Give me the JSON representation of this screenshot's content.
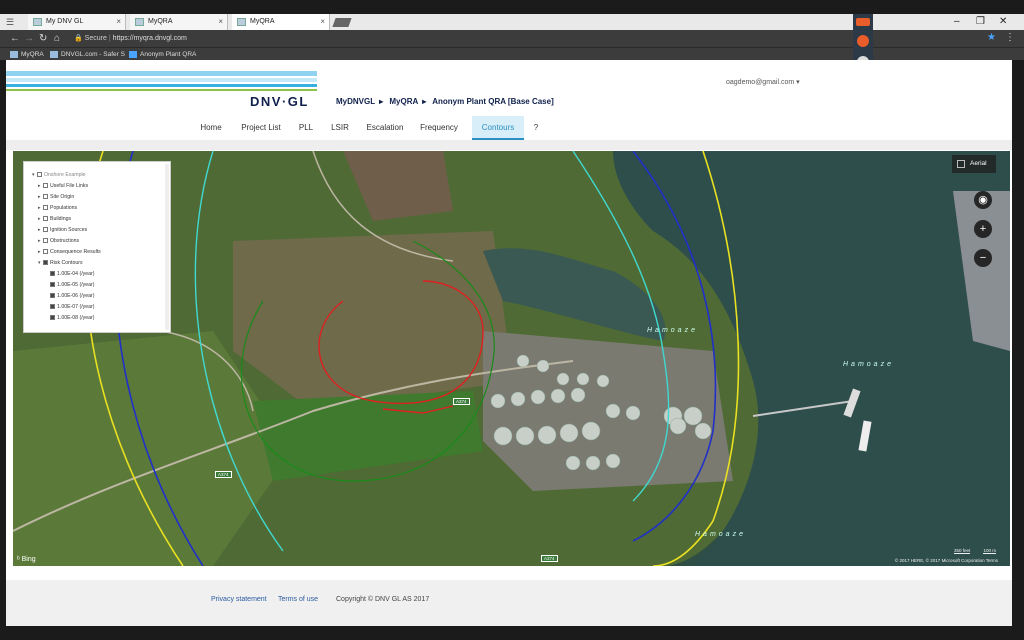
{
  "browser": {
    "tabs": [
      {
        "label": "My DNV GL"
      },
      {
        "label": "MyQRA"
      },
      {
        "label": "MyQRA"
      }
    ],
    "address": {
      "secure_label": "Secure",
      "url": "https://myqra.dnvgl.com"
    },
    "bookmarks": [
      {
        "label": "MyQRA"
      },
      {
        "label": "DNVGL.com - Safer S"
      },
      {
        "label": "Anonym Plant QRA"
      }
    ]
  },
  "header": {
    "logo_text": "DNV·GL",
    "breadcrumb": [
      "MyDNVGL",
      "MyQRA",
      "Anonym Plant QRA [Base Case]"
    ],
    "user": "oagdemo@gmail.com"
  },
  "nav": {
    "tabs": [
      {
        "label": "Home"
      },
      {
        "label": "Project List"
      },
      {
        "label": "PLL"
      },
      {
        "label": "LSIR"
      },
      {
        "label": "Escalation"
      },
      {
        "label": "Frequency"
      },
      {
        "label": "Contours"
      },
      {
        "label": "?"
      }
    ],
    "active": "Contours"
  },
  "layers": {
    "root": "Onshore Example",
    "items": [
      {
        "label": "Useful File Links",
        "checked": false
      },
      {
        "label": "Site Origin",
        "checked": false
      },
      {
        "label": "Populations",
        "checked": false
      },
      {
        "label": "Buildings",
        "checked": false
      },
      {
        "label": "Ignition Sources",
        "checked": false
      },
      {
        "label": "Obstructions",
        "checked": false
      },
      {
        "label": "Consequence Results",
        "checked": false
      },
      {
        "label": "Risk Contours",
        "checked": true
      }
    ],
    "contours": [
      {
        "label": "1.00E-04 (/year)",
        "color": "#e02020"
      },
      {
        "label": "1.00E-05 (/year)",
        "color": "#1a8a1a"
      },
      {
        "label": "1.00E-06 (/year)",
        "color": "#2030c8"
      },
      {
        "label": "1.00E-07 (/year)",
        "color": "#40d8d0"
      },
      {
        "label": "1.00E-08 (/year)",
        "color": "#e8e020"
      }
    ]
  },
  "map": {
    "style_label": "Aerial",
    "bing_label": "Bing",
    "copyright": "© 2017 HERE, © 2017 Microsoft Corporation  Terms",
    "scale_ft": "350 feet",
    "scale_m": "100 m",
    "place_labels": [
      "Hamoaze",
      "Hamoaze",
      "Hamoaze"
    ],
    "road_labels": [
      "A374",
      "A374",
      "A374"
    ]
  },
  "footer": {
    "privacy": "Privacy statement",
    "terms": "Terms of use",
    "copyright": "Copyright © DNV GL AS 2017"
  },
  "colors": {
    "brand_navy": "#0f204b",
    "brand_cyan": "#2a8fc4",
    "logo_bar_top": "#8fd3f0",
    "logo_bar_mid": "#3ab0e0",
    "logo_bar_green": "#8bc34a"
  }
}
